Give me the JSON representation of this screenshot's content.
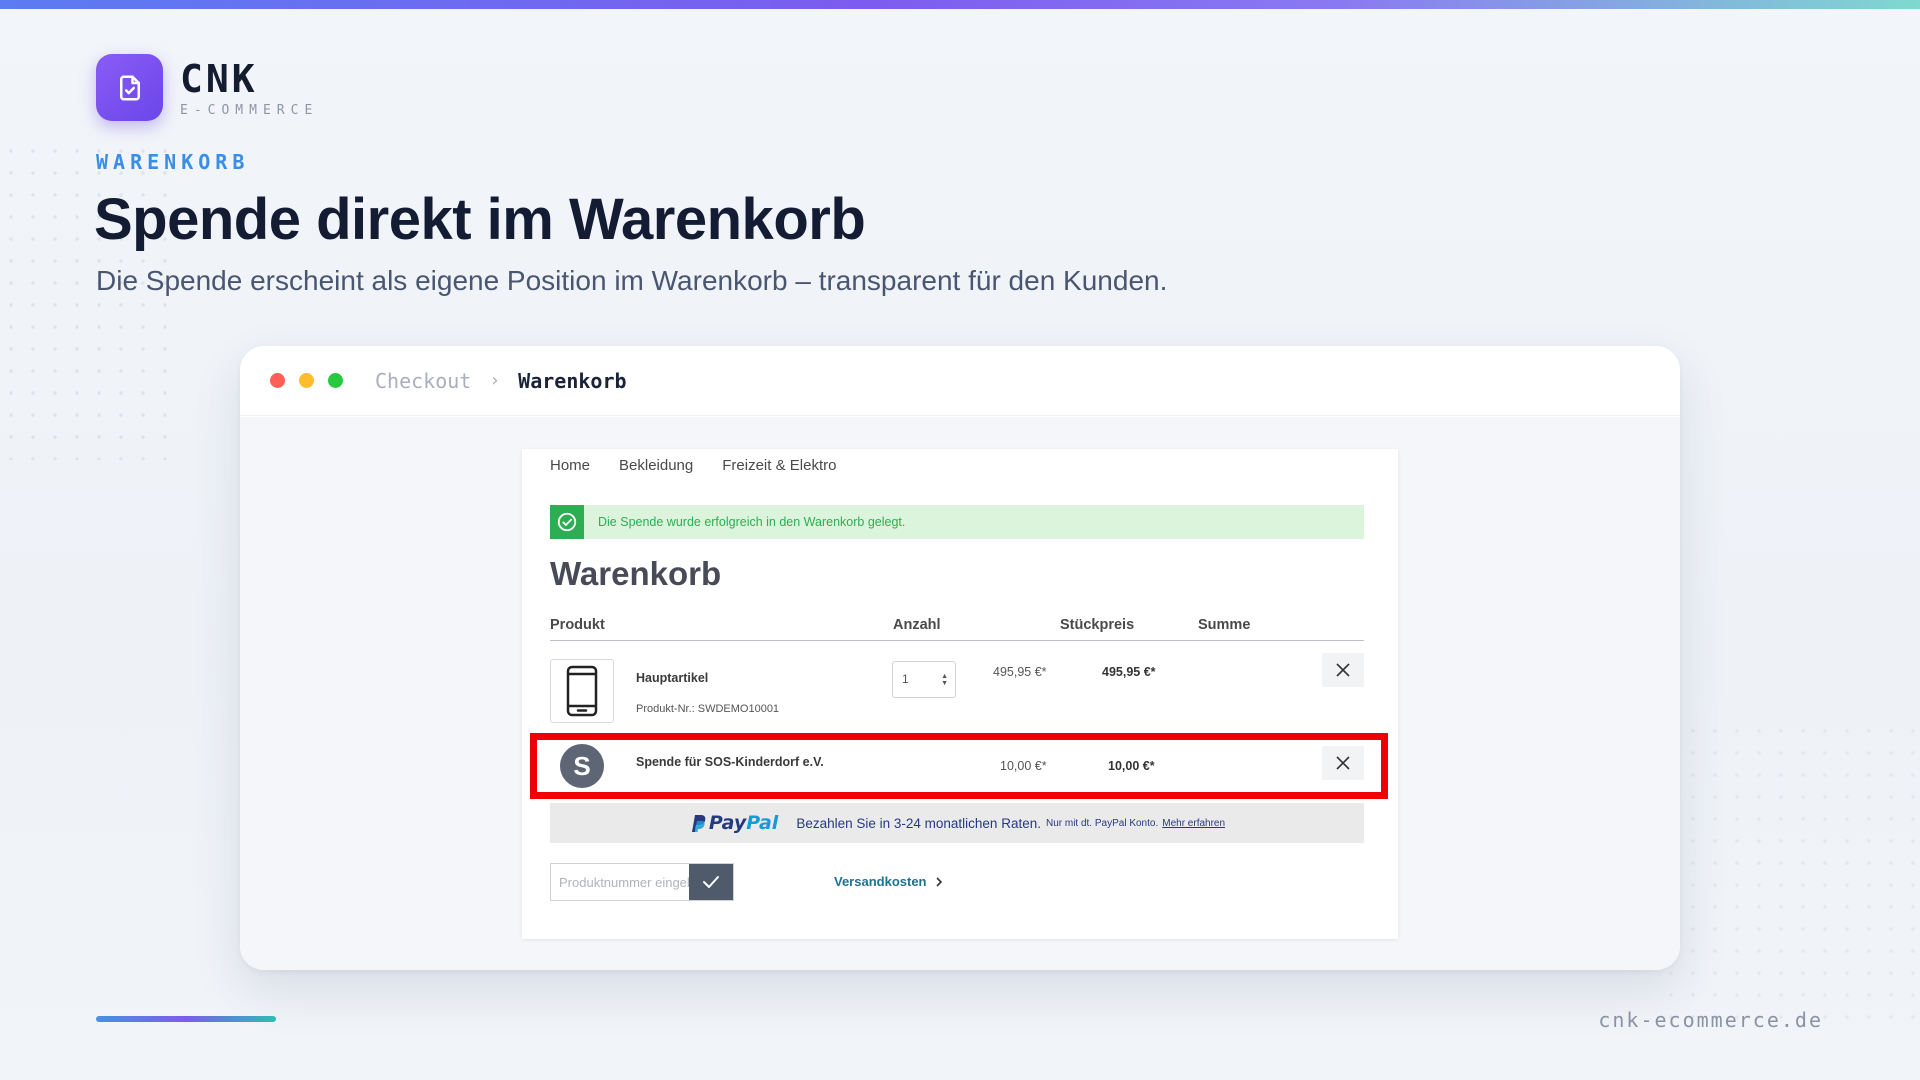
{
  "brand": {
    "name": "CNK",
    "subtitle": "E-COMMERCE"
  },
  "section_label": "WARENKORB",
  "headline": "Spende direkt im Warenkorb",
  "subheadline": "Die Spende erscheint als eigene Position im Warenkorb – transparent für den Kunden.",
  "window": {
    "breadcrumb": {
      "parent": "Checkout",
      "separator": "›",
      "current": "Warenkorb"
    },
    "traffic_lights": [
      "#ff5f57",
      "#febc2e",
      "#28c840"
    ]
  },
  "shop": {
    "nav": [
      "Home",
      "Bekleidung",
      "Freizeit & Elektro"
    ],
    "alert": {
      "text": "Die Spende wurde erfolgreich in den Warenkorb gelegt.",
      "color": "#2fad53"
    },
    "title": "Warenkorb",
    "columns": {
      "product": "Produkt",
      "qty": "Anzahl",
      "unit_price": "Stückpreis",
      "total": "Summe"
    },
    "items": [
      {
        "name": "Hauptartikel",
        "sku": "Produkt-Nr.: SWDEMO10001",
        "qty": "1",
        "unit_price": "495,95 €*",
        "total": "495,95 €*",
        "icon": "smartphone-icon"
      },
      {
        "name": "Spende für SOS-Kinderdorf e.V.",
        "avatar_letter": "S",
        "unit_price": "10,00 €*",
        "total": "10,00 €*"
      }
    ],
    "highlight_color": "#f00000",
    "paypal": {
      "logo_part1": "Pay",
      "logo_part2": "Pal",
      "text": "Bezahlen Sie in 3-24 monatlichen Raten.",
      "small": "Nur mit dt. PayPal Konto.",
      "link": "Mehr erfahren"
    },
    "product_number": {
      "placeholder": "Produktnummer eingeben ..."
    },
    "shipping_link": "Versandkosten"
  },
  "footer": {
    "domain": "cnk-ecommerce.de"
  },
  "colors": {
    "accent": "#3a8ee6",
    "brand": "#7c5cf0",
    "shipping_link": "#1e7290"
  }
}
